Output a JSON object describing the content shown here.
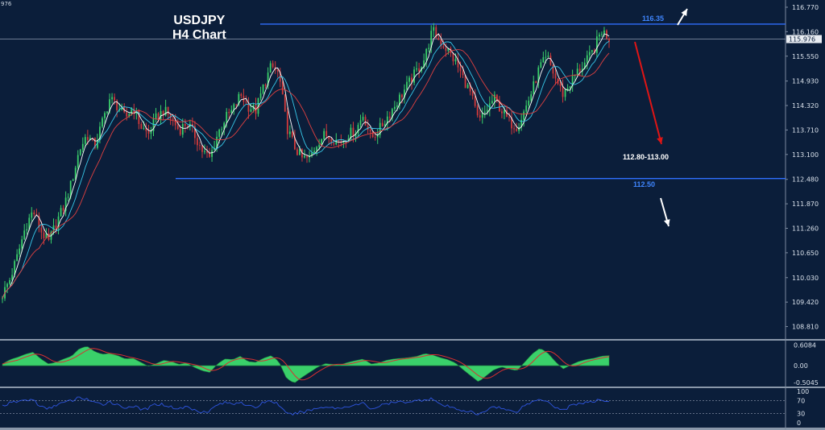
{
  "corner_label": "976",
  "title_line1": "USDJPY",
  "title_line2": "H4 Chart",
  "colors": {
    "background": "#0b1e3a",
    "level_line": "#2f6fff",
    "level_text": "#3f86ff",
    "target_text": "#ffffff",
    "arrow_down": "#e01515",
    "arrow_white": "#ffffff",
    "bull_candle": "#3ad06a",
    "bear_candle": "#d23a3a",
    "ma_fast": "#ffffff",
    "ma_mid": "#38c8e8",
    "ma_slow": "#e04040",
    "macd_hist": "#3ad06a",
    "macd_signal": "#d83030",
    "rsi_line": "#2f55e0",
    "axis_text": "#d8e0ea"
  },
  "annotations": {
    "resistance_label": "116.35",
    "support_label": "112.50",
    "target_label": "112.80-113.00",
    "current_price": "115.976"
  },
  "chart_data": [
    {
      "type": "candlestick",
      "title": "USDJPY H4 Chart",
      "xlabel": "",
      "ylabel": "",
      "ylim": [
        108.5,
        116.95
      ],
      "y_ticks": [
        "116.770",
        "116.160",
        "115.550",
        "114.930",
        "114.320",
        "113.710",
        "113.100",
        "112.480",
        "111.870",
        "111.260",
        "110.650",
        "110.030",
        "109.420",
        "108.810"
      ],
      "horizontal_levels": [
        116.35,
        115.976,
        112.5
      ],
      "price_path": [
        109.6,
        110.0,
        110.6,
        111.3,
        111.7,
        111.2,
        110.9,
        111.4,
        111.8,
        112.4,
        113.2,
        113.6,
        113.3,
        113.9,
        114.5,
        114.3,
        114.0,
        114.3,
        113.8,
        113.6,
        114.0,
        114.2,
        114.0,
        113.7,
        113.9,
        113.6,
        113.2,
        113.0,
        113.6,
        114.0,
        114.2,
        114.6,
        114.3,
        114.2,
        114.8,
        115.3,
        115.1,
        113.8,
        113.3,
        113.0,
        113.0,
        113.4,
        113.6,
        113.5,
        113.4,
        113.6,
        113.7,
        114.1,
        113.5,
        113.7,
        114.0,
        114.3,
        114.6,
        114.9,
        115.2,
        115.5,
        116.2,
        115.9,
        115.7,
        115.4,
        115.0,
        114.6,
        113.9,
        114.2,
        114.5,
        114.2,
        113.9,
        113.8,
        114.2,
        114.7,
        115.3,
        115.5,
        115.0,
        114.6,
        114.9,
        115.2,
        115.4,
        115.7,
        116.2,
        116.0
      ],
      "last_price": 115.976
    },
    {
      "type": "area",
      "title": "",
      "ylim": [
        -0.62,
        0.72
      ],
      "y_ticks": [
        "0.6084",
        "0.00",
        "-0.5045"
      ],
      "values": [
        0.05,
        0.18,
        0.25,
        0.34,
        0.4,
        0.2,
        0.05,
        0.1,
        0.2,
        0.28,
        0.5,
        0.58,
        0.42,
        0.34,
        0.36,
        0.3,
        0.2,
        0.22,
        0.1,
        -0.02,
        0.06,
        0.16,
        0.12,
        0.04,
        0.08,
        -0.05,
        -0.15,
        -0.2,
        0.05,
        0.2,
        0.18,
        0.28,
        0.12,
        0.1,
        0.22,
        0.3,
        0.12,
        -0.38,
        -0.52,
        -0.35,
        -0.2,
        -0.05,
        0.06,
        0.04,
        0.02,
        0.1,
        0.15,
        0.2,
        0.05,
        0.08,
        0.16,
        0.2,
        0.22,
        0.24,
        0.28,
        0.36,
        0.32,
        0.24,
        0.18,
        0.08,
        -0.12,
        -0.3,
        -0.48,
        -0.3,
        -0.12,
        -0.04,
        -0.1,
        -0.15,
        0.1,
        0.35,
        0.52,
        0.38,
        0.12,
        -0.1,
        0.02,
        0.12,
        0.18,
        0.22,
        0.28,
        0.3
      ]
    },
    {
      "type": "line",
      "title": "",
      "ylim": [
        0,
        100
      ],
      "y_ticks": [
        "100",
        "70",
        "30",
        "0"
      ],
      "reference_levels": [
        70,
        30
      ],
      "values": [
        55,
        62,
        68,
        72,
        74,
        50,
        44,
        58,
        64,
        70,
        80,
        76,
        62,
        58,
        68,
        56,
        48,
        54,
        42,
        46,
        60,
        58,
        50,
        44,
        52,
        40,
        36,
        38,
        58,
        64,
        60,
        68,
        52,
        48,
        66,
        70,
        58,
        26,
        28,
        34,
        40,
        46,
        52,
        48,
        46,
        54,
        56,
        62,
        44,
        52,
        60,
        64,
        66,
        68,
        70,
        74,
        78,
        56,
        52,
        44,
        40,
        34,
        24,
        40,
        54,
        46,
        38,
        36,
        56,
        66,
        76,
        70,
        50,
        40,
        54,
        62,
        64,
        66,
        74,
        68
      ]
    }
  ]
}
